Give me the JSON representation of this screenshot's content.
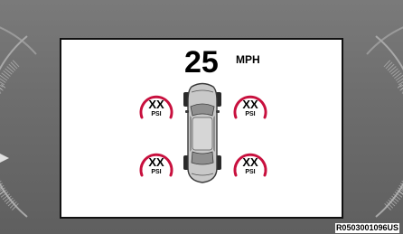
{
  "display": {
    "speed_value": "25",
    "speed_unit": "MPH"
  },
  "tires": {
    "front_left": {
      "value": "XX",
      "unit": "PSI"
    },
    "front_right": {
      "value": "XX",
      "unit": "PSI"
    },
    "rear_left": {
      "value": "XX",
      "unit": "PSI"
    },
    "rear_right": {
      "value": "XX",
      "unit": "PSI"
    }
  },
  "figure_code": "R0503001096US",
  "colors": {
    "cluster_bg": "#6e6e6e",
    "screen_bg": "#ffffff",
    "tire_arc": "#c8103e",
    "vehicle_body": "#c9c9c9"
  },
  "icons": {
    "vehicle": "car-top-view-icon",
    "tire_gauge": "tire-pressure-arc-icon"
  }
}
